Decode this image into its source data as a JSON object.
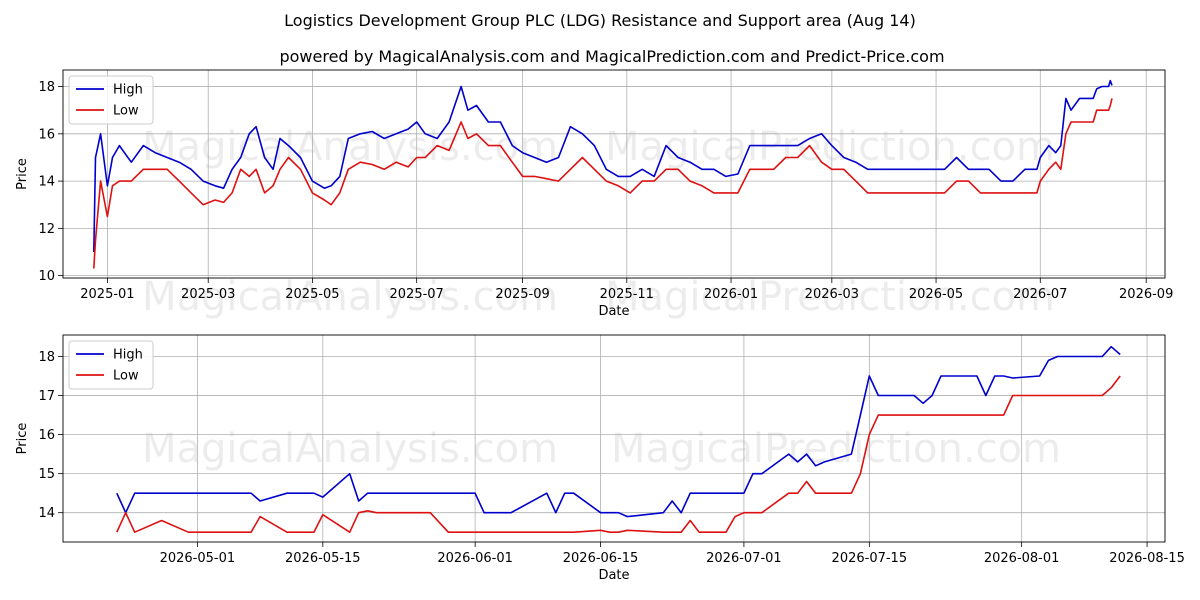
{
  "page": {
    "title": "Logistics Development Group PLC (LDG) Resistance and Support area (Aug 14)",
    "subtitle": "powered by MagicalAnalysis.com and MagicalPrediction.com and Predict-Price.com",
    "watermark_left": "MagicalAnalysis.com",
    "watermark_right": "MagicalPrediction.com"
  },
  "colors": {
    "high": "#0000cc",
    "low": "#dd1111",
    "grid": "#b0b0b0"
  },
  "chart_data": [
    {
      "type": "line",
      "xlabel": "Date",
      "ylabel": "Price",
      "xlim": [
        "2024-12-06",
        "2026-09-12"
      ],
      "ylim": [
        9.9,
        18.7
      ],
      "xticks": [
        "2025-01-01",
        "2025-03-01",
        "2025-05-01",
        "2025-07-01",
        "2025-09-01",
        "2025-11-01",
        "2026-01-01",
        "2026-03-01",
        "2026-05-01",
        "2026-07-01",
        "2026-09-01"
      ],
      "xtick_labels": [
        "2025-01",
        "2025-03",
        "2025-05",
        "2025-07",
        "2025-09",
        "2025-11",
        "2026-01",
        "2026-03",
        "2026-05",
        "2026-07",
        "2026-09"
      ],
      "yticks": [
        10,
        12,
        14,
        16,
        18
      ],
      "grid": true,
      "legend": "top-left",
      "series": [
        {
          "name": "High",
          "x": [
            "2024-12-24",
            "2024-12-25",
            "2024-12-28",
            "2025-01-01",
            "2025-01-04",
            "2025-01-08",
            "2025-01-15",
            "2025-01-22",
            "2025-01-29",
            "2025-02-05",
            "2025-02-12",
            "2025-02-19",
            "2025-02-26",
            "2025-03-05",
            "2025-03-10",
            "2025-03-15",
            "2025-03-20",
            "2025-03-25",
            "2025-03-29",
            "2025-04-03",
            "2025-04-08",
            "2025-04-12",
            "2025-04-17",
            "2025-04-24",
            "2025-05-01",
            "2025-05-08",
            "2025-05-12",
            "2025-05-17",
            "2025-05-22",
            "2025-05-29",
            "2025-06-05",
            "2025-06-12",
            "2025-06-19",
            "2025-06-26",
            "2025-07-01",
            "2025-07-06",
            "2025-07-13",
            "2025-07-20",
            "2025-07-27",
            "2025-07-31",
            "2025-08-05",
            "2025-08-12",
            "2025-08-19",
            "2025-08-26",
            "2025-09-01",
            "2025-09-08",
            "2025-09-15",
            "2025-09-22",
            "2025-09-29",
            "2025-10-06",
            "2025-10-13",
            "2025-10-20",
            "2025-10-27",
            "2025-11-03",
            "2025-11-10",
            "2025-11-17",
            "2025-11-24",
            "2025-12-01",
            "2025-12-08",
            "2025-12-15",
            "2025-12-22",
            "2025-12-29",
            "2026-01-05",
            "2026-01-12",
            "2026-01-19",
            "2026-01-26",
            "2026-02-02",
            "2026-02-09",
            "2026-02-16",
            "2026-02-23",
            "2026-03-01",
            "2026-03-08",
            "2026-03-15",
            "2026-03-22",
            "2026-03-29",
            "2026-04-05",
            "2026-04-12",
            "2026-04-19",
            "2026-04-22",
            "2026-04-29",
            "2026-05-06",
            "2026-05-13",
            "2026-05-20",
            "2026-05-27",
            "2026-06-01",
            "2026-06-08",
            "2026-06-15",
            "2026-06-22",
            "2026-06-29",
            "2026-07-01",
            "2026-07-06",
            "2026-07-10",
            "2026-07-13",
            "2026-07-16",
            "2026-07-19",
            "2026-07-24",
            "2026-07-27",
            "2026-08-01",
            "2026-08-03",
            "2026-08-06",
            "2026-08-10",
            "2026-08-11",
            "2026-08-12"
          ],
          "y": [
            11.0,
            15.0,
            16.0,
            13.8,
            15.0,
            15.5,
            14.8,
            15.5,
            15.2,
            15.0,
            14.8,
            14.5,
            14.0,
            13.8,
            13.7,
            14.5,
            15.0,
            16.0,
            16.3,
            15.0,
            14.5,
            15.8,
            15.5,
            15.0,
            14.0,
            13.7,
            13.8,
            14.2,
            15.8,
            16.0,
            16.1,
            15.8,
            16.0,
            16.2,
            16.5,
            16.0,
            15.8,
            16.5,
            18.0,
            17.0,
            17.2,
            16.5,
            16.5,
            15.5,
            15.2,
            15.0,
            14.8,
            15.0,
            16.3,
            16.0,
            15.5,
            14.5,
            14.2,
            14.2,
            14.5,
            14.2,
            15.5,
            15.0,
            14.8,
            14.5,
            14.5,
            14.2,
            14.3,
            15.5,
            15.5,
            15.5,
            15.5,
            15.5,
            15.8,
            16.0,
            15.5,
            15.0,
            14.8,
            14.5,
            14.5,
            14.5,
            14.5,
            14.5,
            14.5,
            14.5,
            14.5,
            15.0,
            14.5,
            14.5,
            14.5,
            14.0,
            14.0,
            14.5,
            14.5,
            15.0,
            15.5,
            15.2,
            15.5,
            17.5,
            17.0,
            17.5,
            17.5,
            17.5,
            17.9,
            18.0,
            18.0,
            18.25,
            18.05
          ]
        },
        {
          "name": "Low",
          "x": [
            "2024-12-24",
            "2024-12-25",
            "2024-12-28",
            "2025-01-01",
            "2025-01-04",
            "2025-01-08",
            "2025-01-15",
            "2025-01-22",
            "2025-01-29",
            "2025-02-05",
            "2025-02-12",
            "2025-02-19",
            "2025-02-26",
            "2025-03-05",
            "2025-03-10",
            "2025-03-15",
            "2025-03-20",
            "2025-03-25",
            "2025-03-29",
            "2025-04-03",
            "2025-04-08",
            "2025-04-12",
            "2025-04-17",
            "2025-04-24",
            "2025-05-01",
            "2025-05-08",
            "2025-05-12",
            "2025-05-17",
            "2025-05-22",
            "2025-05-29",
            "2025-06-05",
            "2025-06-12",
            "2025-06-19",
            "2025-06-26",
            "2025-07-01",
            "2025-07-06",
            "2025-07-13",
            "2025-07-20",
            "2025-07-27",
            "2025-07-31",
            "2025-08-05",
            "2025-08-12",
            "2025-08-19",
            "2025-08-26",
            "2025-09-01",
            "2025-09-08",
            "2025-09-15",
            "2025-09-22",
            "2025-09-29",
            "2025-10-06",
            "2025-10-13",
            "2025-10-20",
            "2025-10-27",
            "2025-11-03",
            "2025-11-10",
            "2025-11-17",
            "2025-11-24",
            "2025-12-01",
            "2025-12-08",
            "2025-12-15",
            "2025-12-22",
            "2025-12-29",
            "2026-01-05",
            "2026-01-12",
            "2026-01-19",
            "2026-01-26",
            "2026-02-02",
            "2026-02-09",
            "2026-02-16",
            "2026-02-23",
            "2026-03-01",
            "2026-03-08",
            "2026-03-15",
            "2026-03-22",
            "2026-03-29",
            "2026-04-05",
            "2026-04-12",
            "2026-04-19",
            "2026-04-22",
            "2026-04-29",
            "2026-05-06",
            "2026-05-13",
            "2026-05-20",
            "2026-05-27",
            "2026-06-01",
            "2026-06-08",
            "2026-06-15",
            "2026-06-22",
            "2026-06-29",
            "2026-07-01",
            "2026-07-06",
            "2026-07-10",
            "2026-07-13",
            "2026-07-16",
            "2026-07-19",
            "2026-07-24",
            "2026-07-27",
            "2026-08-01",
            "2026-08-03",
            "2026-08-06",
            "2026-08-10",
            "2026-08-11",
            "2026-08-12"
          ],
          "y": [
            10.3,
            11.5,
            14.0,
            12.5,
            13.8,
            14.0,
            14.0,
            14.5,
            14.5,
            14.5,
            14.0,
            13.5,
            13.0,
            13.2,
            13.1,
            13.5,
            14.5,
            14.2,
            14.5,
            13.5,
            13.8,
            14.5,
            15.0,
            14.5,
            13.5,
            13.2,
            13.0,
            13.5,
            14.5,
            14.8,
            14.7,
            14.5,
            14.8,
            14.6,
            15.0,
            15.0,
            15.5,
            15.3,
            16.5,
            15.8,
            16.0,
            15.5,
            15.5,
            14.8,
            14.2,
            14.2,
            14.1,
            14.0,
            14.5,
            15.0,
            14.5,
            14.0,
            13.8,
            13.5,
            14.0,
            14.0,
            14.5,
            14.5,
            14.0,
            13.8,
            13.5,
            13.5,
            13.5,
            14.5,
            14.5,
            14.5,
            15.0,
            15.0,
            15.5,
            14.8,
            14.5,
            14.5,
            14.0,
            13.5,
            13.5,
            13.5,
            13.5,
            13.5,
            13.5,
            13.5,
            13.5,
            14.0,
            14.0,
            13.5,
            13.5,
            13.5,
            13.5,
            13.5,
            13.5,
            14.0,
            14.5,
            14.8,
            14.5,
            16.0,
            16.5,
            16.5,
            16.5,
            16.5,
            17.0,
            17.0,
            17.0,
            17.2,
            17.5
          ]
        }
      ]
    },
    {
      "type": "line",
      "xlabel": "Date",
      "ylabel": "Price",
      "xlim": [
        "2026-04-16",
        "2026-08-17"
      ],
      "ylim": [
        13.25,
        18.55
      ],
      "xticks": [
        "2026-05-01",
        "2026-05-15",
        "2026-06-01",
        "2026-06-15",
        "2026-07-01",
        "2026-07-15",
        "2026-08-01",
        "2026-08-15"
      ],
      "xtick_labels": [
        "2026-05-01",
        "2026-05-15",
        "2026-06-01",
        "2026-06-15",
        "2026-07-01",
        "2026-07-15",
        "2026-08-01",
        "2026-08-15"
      ],
      "yticks": [
        14,
        15,
        16,
        17,
        18
      ],
      "grid": true,
      "legend": "top-left",
      "series": [
        {
          "name": "High",
          "x": [
            "2026-04-22",
            "2026-04-23",
            "2026-04-24",
            "2026-04-27",
            "2026-04-30",
            "2026-05-01",
            "2026-05-04",
            "2026-05-07",
            "2026-05-08",
            "2026-05-11",
            "2026-05-14",
            "2026-05-15",
            "2026-05-18",
            "2026-05-19",
            "2026-05-20",
            "2026-05-21",
            "2026-05-26",
            "2026-05-27",
            "2026-05-29",
            "2026-06-01",
            "2026-06-02",
            "2026-06-03",
            "2026-06-04",
            "2026-06-05",
            "2026-06-09",
            "2026-06-10",
            "2026-06-11",
            "2026-06-12",
            "2026-06-15",
            "2026-06-16",
            "2026-06-17",
            "2026-06-18",
            "2026-06-22",
            "2026-06-23",
            "2026-06-24",
            "2026-06-25",
            "2026-06-26",
            "2026-06-29",
            "2026-06-30",
            "2026-07-01",
            "2026-07-02",
            "2026-07-03",
            "2026-07-06",
            "2026-07-07",
            "2026-07-08",
            "2026-07-09",
            "2026-07-10",
            "2026-07-13",
            "2026-07-14",
            "2026-07-15",
            "2026-07-16",
            "2026-07-17",
            "2026-07-20",
            "2026-07-21",
            "2026-07-22",
            "2026-07-23",
            "2026-07-24",
            "2026-07-27",
            "2026-07-28",
            "2026-07-29",
            "2026-07-30",
            "2026-07-31",
            "2026-08-03",
            "2026-08-04",
            "2026-08-05",
            "2026-08-06",
            "2026-08-07",
            "2026-08-10",
            "2026-08-11",
            "2026-08-12"
          ],
          "y": [
            14.5,
            14.0,
            14.5,
            14.5,
            14.5,
            14.5,
            14.5,
            14.5,
            14.3,
            14.5,
            14.5,
            14.4,
            15.0,
            14.3,
            14.5,
            14.5,
            14.5,
            14.5,
            14.5,
            14.5,
            14.0,
            14.0,
            14.0,
            14.0,
            14.5,
            14.0,
            14.5,
            14.5,
            14.0,
            14.0,
            14.0,
            13.9,
            14.0,
            14.3,
            14.0,
            14.5,
            14.5,
            14.5,
            14.5,
            14.5,
            15.0,
            15.0,
            15.5,
            15.3,
            15.5,
            15.2,
            15.3,
            15.5,
            16.5,
            17.5,
            17.0,
            17.0,
            17.0,
            16.8,
            17.0,
            17.5,
            17.5,
            17.5,
            17.0,
            17.5,
            17.5,
            17.45,
            17.5,
            17.9,
            18.0,
            18.0,
            18.0,
            18.0,
            18.25,
            18.05
          ]
        },
        {
          "name": "Low",
          "x": [
            "2026-04-22",
            "2026-04-23",
            "2026-04-24",
            "2026-04-27",
            "2026-04-30",
            "2026-05-01",
            "2026-05-04",
            "2026-05-07",
            "2026-05-08",
            "2026-05-11",
            "2026-05-14",
            "2026-05-15",
            "2026-05-18",
            "2026-05-19",
            "2026-05-20",
            "2026-05-21",
            "2026-05-26",
            "2026-05-27",
            "2026-05-29",
            "2026-06-01",
            "2026-06-02",
            "2026-06-03",
            "2026-06-04",
            "2026-06-05",
            "2026-06-09",
            "2026-06-10",
            "2026-06-11",
            "2026-06-12",
            "2026-06-15",
            "2026-06-16",
            "2026-06-17",
            "2026-06-18",
            "2026-06-22",
            "2026-06-23",
            "2026-06-24",
            "2026-06-25",
            "2026-06-26",
            "2026-06-29",
            "2026-06-30",
            "2026-07-01",
            "2026-07-02",
            "2026-07-03",
            "2026-07-06",
            "2026-07-07",
            "2026-07-08",
            "2026-07-09",
            "2026-07-10",
            "2026-07-13",
            "2026-07-14",
            "2026-07-15",
            "2026-07-16",
            "2026-07-17",
            "2026-07-20",
            "2026-07-21",
            "2026-07-22",
            "2026-07-23",
            "2026-07-24",
            "2026-07-27",
            "2026-07-28",
            "2026-07-29",
            "2026-07-30",
            "2026-07-31",
            "2026-08-03",
            "2026-08-04",
            "2026-08-05",
            "2026-08-06",
            "2026-08-07",
            "2026-08-10",
            "2026-08-11",
            "2026-08-12"
          ],
          "y": [
            13.5,
            14.0,
            13.5,
            13.8,
            13.5,
            13.5,
            13.5,
            13.5,
            13.9,
            13.5,
            13.5,
            13.95,
            13.5,
            14.0,
            14.05,
            14.0,
            14.0,
            14.0,
            13.5,
            13.5,
            13.5,
            13.5,
            13.5,
            13.5,
            13.5,
            13.5,
            13.5,
            13.5,
            13.55,
            13.5,
            13.5,
            13.55,
            13.5,
            13.5,
            13.5,
            13.8,
            13.5,
            13.5,
            13.9,
            14.0,
            14.0,
            14.0,
            14.5,
            14.5,
            14.8,
            14.5,
            14.5,
            14.5,
            15.0,
            16.0,
            16.5,
            16.5,
            16.5,
            16.5,
            16.5,
            16.5,
            16.5,
            16.5,
            16.5,
            16.5,
            16.5,
            17.0,
            17.0,
            17.0,
            17.0,
            17.0,
            17.0,
            17.0,
            17.2,
            17.5
          ]
        }
      ]
    }
  ]
}
